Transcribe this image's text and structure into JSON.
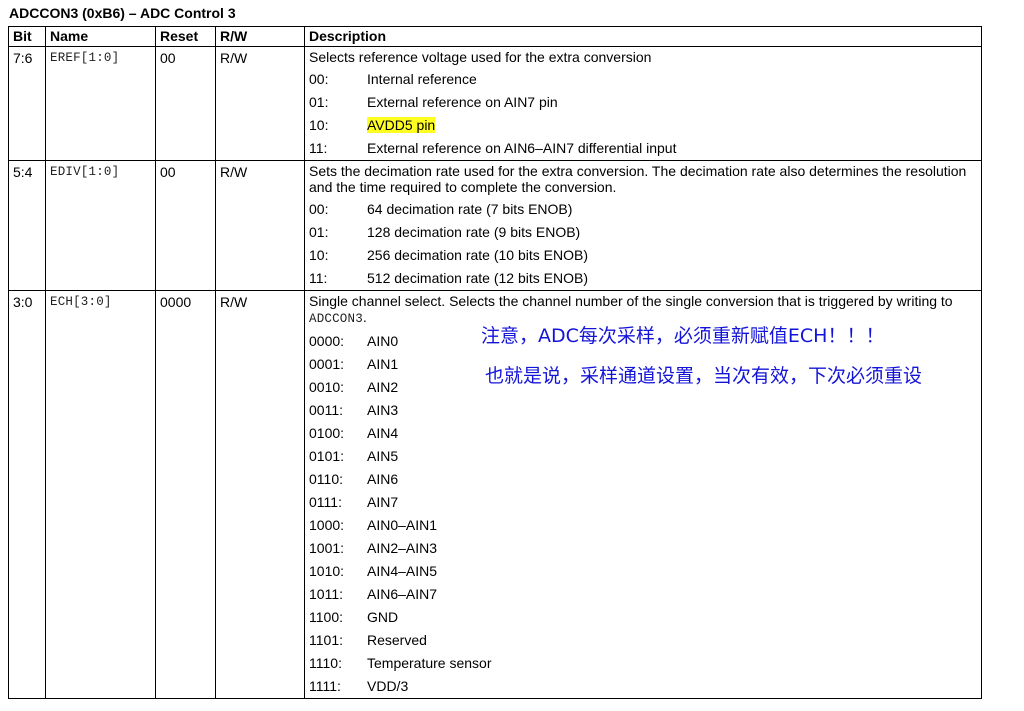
{
  "title": "ADCCON3 (0xB6) – ADC Control 3",
  "headers": {
    "bit": "Bit",
    "name": "Name",
    "reset": "Reset",
    "rw": "R/W",
    "description": "Description"
  },
  "rows": [
    {
      "bit": "7:6",
      "name": "EREF[1:0]",
      "reset": "00",
      "rw": "R/W",
      "desc": "Selects reference voltage used for the extra conversion",
      "options": [
        {
          "code": "00:",
          "text": "Internal reference"
        },
        {
          "code": "01:",
          "text": "External reference on AIN7 pin"
        },
        {
          "code": "10:",
          "text": "AVDD5 pin",
          "highlight": true
        },
        {
          "code": "11:",
          "text": "External reference on AIN6–AIN7 differential input"
        }
      ]
    },
    {
      "bit": "5:4",
      "name": "EDIV[1:0]",
      "reset": "00",
      "rw": "R/W",
      "desc": "Sets the decimation rate used for the extra conversion. The decimation rate also determines the resolution and the time required to complete the conversion.",
      "options": [
        {
          "code": "00:",
          "text": "64 decimation rate (7 bits ENOB)"
        },
        {
          "code": "01:",
          "text": "128 decimation rate (9 bits ENOB)"
        },
        {
          "code": "10:",
          "text": "256 decimation rate (10 bits ENOB)"
        },
        {
          "code": "11:",
          "text": "512 decimation rate (12 bits ENOB)"
        }
      ]
    },
    {
      "bit": "3:0",
      "name": "ECH[3:0]",
      "reset": "0000",
      "rw": "R/W",
      "desc": "Single channel select. Selects the channel number of the single conversion that is triggered by writing to",
      "desc_code": "ADCCON3",
      "desc_end": ".",
      "options": [
        {
          "code": "0000:",
          "text": "AIN0"
        },
        {
          "code": "0001:",
          "text": "AIN1"
        },
        {
          "code": "0010:",
          "text": "AIN2"
        },
        {
          "code": "0011:",
          "text": "AIN3"
        },
        {
          "code": "0100:",
          "text": "AIN4"
        },
        {
          "code": "0101:",
          "text": "AIN5"
        },
        {
          "code": "0110:",
          "text": "AIN6"
        },
        {
          "code": "0111:",
          "text": "AIN7"
        },
        {
          "code": "1000:",
          "text": "AIN0–AIN1"
        },
        {
          "code": "1001:",
          "text": "AIN2–AIN3"
        },
        {
          "code": "1010:",
          "text": "AIN4–AIN5"
        },
        {
          "code": "1011:",
          "text": "AIN6–AIN7"
        },
        {
          "code": "1100:",
          "text": "GND"
        },
        {
          "code": "1101:",
          "text": "Reserved"
        },
        {
          "code": "1110:",
          "text": "Temperature sensor"
        },
        {
          "code": "1111:",
          "text": "VDD/3"
        }
      ]
    }
  ],
  "annotations": {
    "note1": "注意，ADC每次采样，必须重新赋值ECH！！！",
    "note2": "也就是说，采样通道设置，当次有效，下次必须重设"
  },
  "colors": {
    "annotation": "#1414d8",
    "highlight": "#ffff22"
  }
}
